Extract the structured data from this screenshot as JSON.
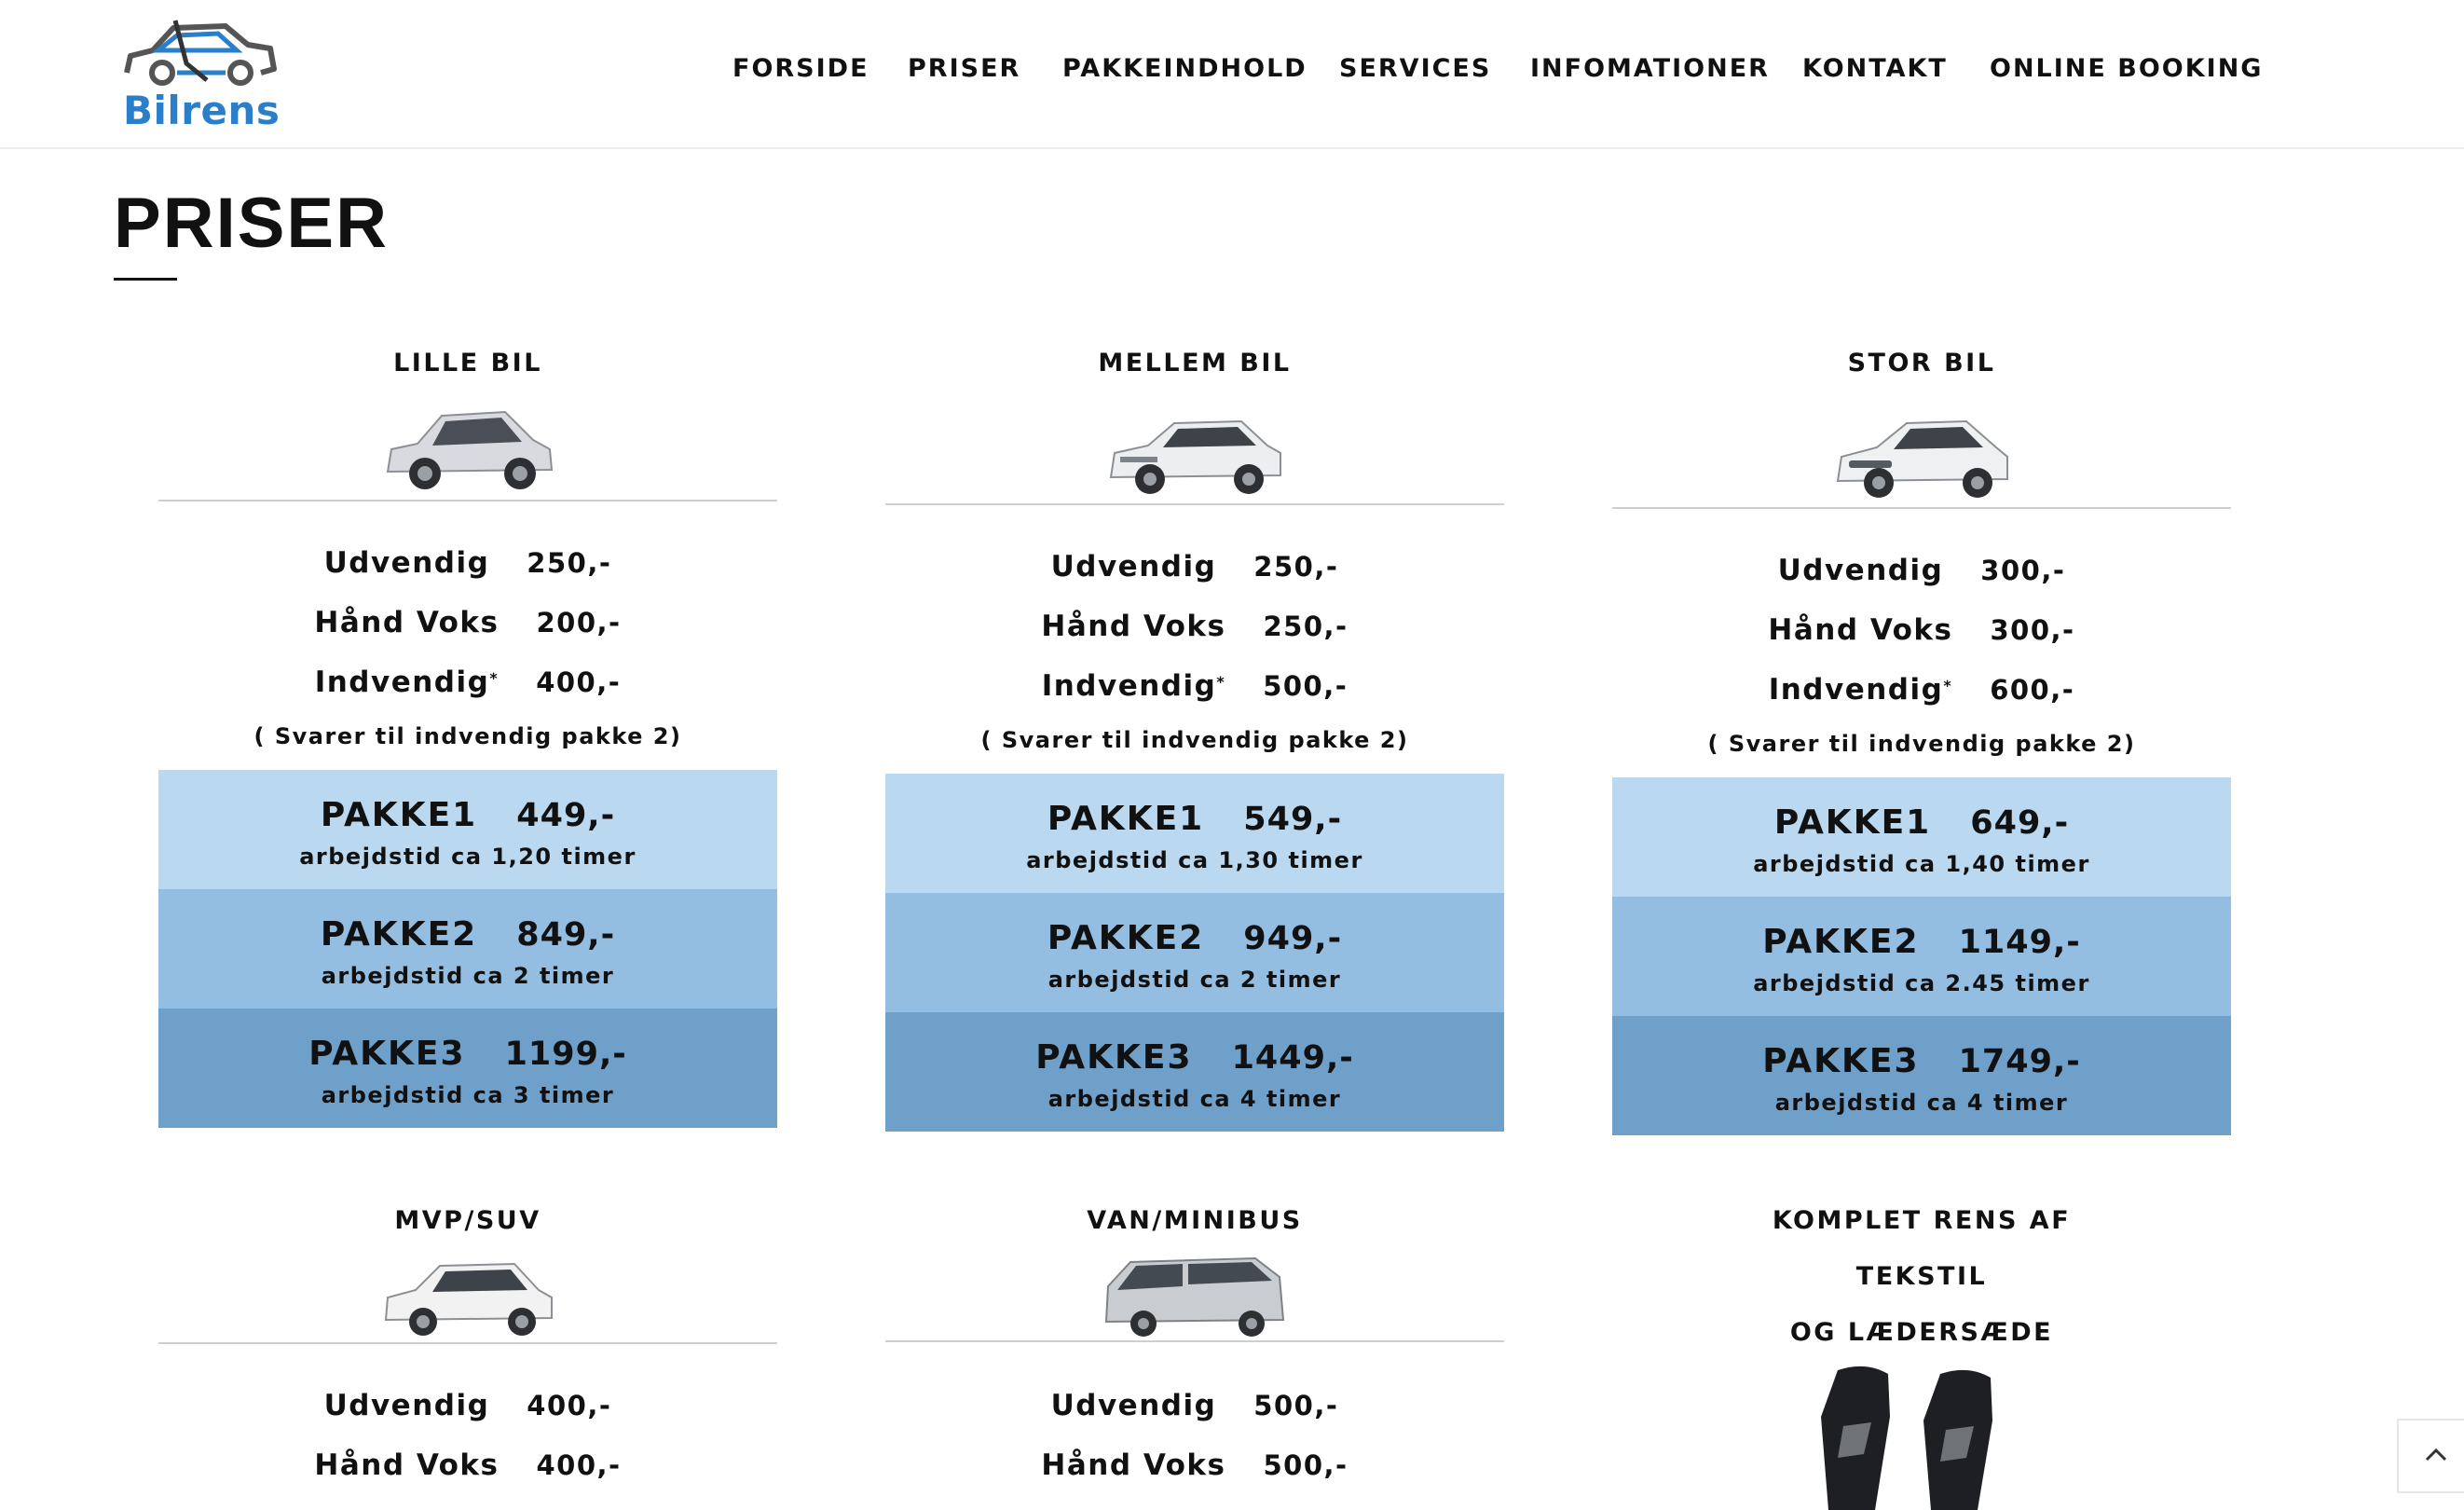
{
  "header": {
    "logo_text": "Bilrens",
    "nav": [
      "FORSIDE",
      "PRISER",
      "PAKKEINDHOLD",
      "SERVICES",
      "INFOMATIONER",
      "KONTAKT",
      "ONLINE BOOKING"
    ]
  },
  "page": {
    "title": "PRISER"
  },
  "cards": [
    {
      "title": "LILLE BIL",
      "image": "small-car-image",
      "rows": [
        {
          "label": "Udvendig",
          "value": "250,-"
        },
        {
          "label": "Hånd Voks",
          "value": "200,-"
        },
        {
          "label": "Indvendig",
          "sup": "*",
          "value": "400,-"
        }
      ],
      "note": "( Svarer til indvendig pakke 2)",
      "packages": [
        {
          "name": "PAKKE1",
          "price": "449,-",
          "work": "arbejdstid ca 1,20 timer"
        },
        {
          "name": "PAKKE2",
          "price": "849,-",
          "work": "arbejdstid ca 2 timer"
        },
        {
          "name": "PAKKE3",
          "price": "1199,-",
          "work": "arbejdstid ca 3 timer"
        }
      ]
    },
    {
      "title": "MELLEM BIL",
      "image": "medium-car-image",
      "rows": [
        {
          "label": "Udvendig",
          "value": "250,-"
        },
        {
          "label": "Hånd Voks",
          "value": "250,-"
        },
        {
          "label": "Indvendig",
          "sup": "*",
          "value": "500,-"
        }
      ],
      "note": "( Svarer til indvendig pakke 2)",
      "packages": [
        {
          "name": "PAKKE1",
          "price": "549,-",
          "work": "arbejdstid ca 1,30 timer"
        },
        {
          "name": "PAKKE2",
          "price": "949,-",
          "work": "arbejdstid ca 2 timer"
        },
        {
          "name": "PAKKE3",
          "price": "1449,-",
          "work": "arbejdstid ca 4 timer"
        }
      ]
    },
    {
      "title": "STOR BIL",
      "image": "large-car-image",
      "rows": [
        {
          "label": "Udvendig",
          "value": "300,-"
        },
        {
          "label": "Hånd Voks",
          "value": "300,-"
        },
        {
          "label": "Indvendig",
          "sup": "*",
          "value": "600,-"
        }
      ],
      "note": "( Svarer til indvendig pakke 2)",
      "packages": [
        {
          "name": "PAKKE1",
          "price": "649,-",
          "work": "arbejdstid ca 1,40 timer"
        },
        {
          "name": "PAKKE2",
          "price": "1149,-",
          "work": "arbejdstid ca 2.45 timer"
        },
        {
          "name": "PAKKE3",
          "price": "1749,-",
          "work": "arbejdstid ca 4 timer"
        }
      ]
    },
    {
      "title": "MVP/SUV",
      "image": "suv-image",
      "rows": [
        {
          "label": "Udvendig",
          "value": "400,-"
        },
        {
          "label": "Hånd Voks",
          "value": "400,-"
        }
      ]
    },
    {
      "title": "VAN/MINIBUS",
      "image": "van-image",
      "rows": [
        {
          "label": "Udvendig",
          "value": "500,-"
        },
        {
          "label": "Hånd Voks",
          "value": "500,-"
        }
      ]
    },
    {
      "title_lines": [
        "KOMPLET RENS AF",
        "TEKSTIL",
        "OG LÆDERSÆDE"
      ],
      "image": "car-seats-image"
    }
  ]
}
